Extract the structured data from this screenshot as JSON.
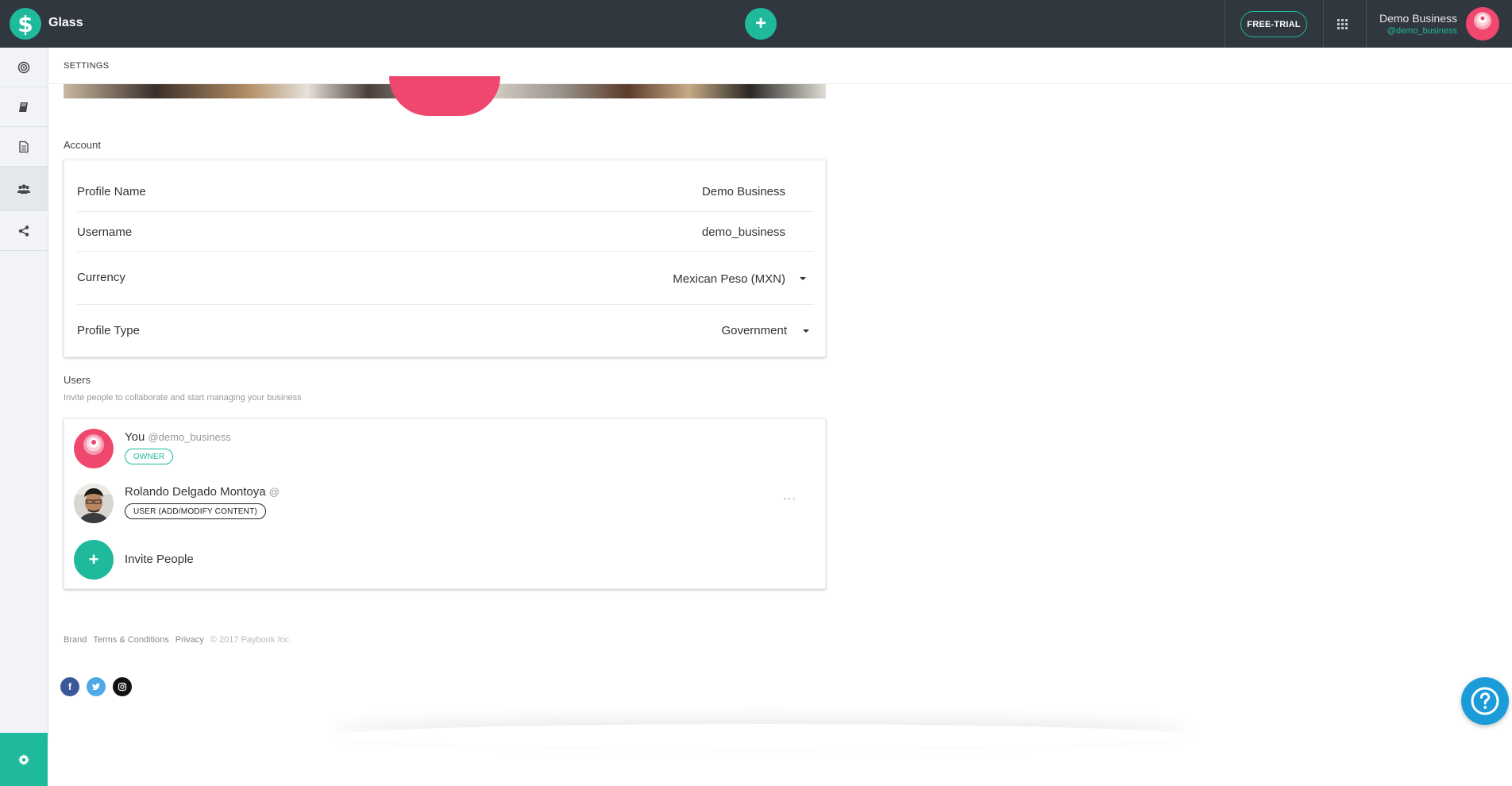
{
  "app": {
    "title": "Glass",
    "logo_glyph": "$"
  },
  "topbar": {
    "add_glyph": "+",
    "free_trial_label": "FREE-TRIAL",
    "user": {
      "name": "Demo Business",
      "handle": "@demo_business"
    }
  },
  "sidebar": {
    "items": [
      {
        "icon": "target-icon"
      },
      {
        "icon": "book-icon"
      },
      {
        "icon": "document-icon"
      },
      {
        "icon": "users-icon"
      },
      {
        "icon": "share-icon"
      }
    ],
    "settings_icon": "gear-icon"
  },
  "page": {
    "title": "SETTINGS"
  },
  "account": {
    "section_title": "Account",
    "rows": [
      {
        "label": "Profile Name",
        "value": "Demo Business"
      },
      {
        "label": "Username",
        "value": "demo_business"
      },
      {
        "label": "Currency",
        "value": "Mexican Peso (MXN)"
      },
      {
        "label": "Profile Type",
        "value": "Government"
      }
    ]
  },
  "users": {
    "section_title": "Users",
    "subtitle": "Invite people to collaborate and start managing your business",
    "list": [
      {
        "name": "You",
        "handle": "@demo_business",
        "role": "OWNER"
      },
      {
        "name": "Rolando Delgado Montoya",
        "handle": "@",
        "role": "USER (ADD/MODIFY CONTENT)",
        "more": "···"
      }
    ],
    "invite": {
      "glyph": "+",
      "label": "Invite People"
    }
  },
  "footer": {
    "links": [
      "Brand",
      "Terms & Conditions",
      "Privacy"
    ],
    "copyright": "© 2017 Paybook Inc.",
    "social": [
      {
        "name": "facebook",
        "glyph": "f"
      },
      {
        "name": "twitter",
        "glyph": "t"
      },
      {
        "name": "instagram",
        "glyph": "◎"
      }
    ]
  },
  "colors": {
    "accent": "#1fba9c",
    "topbar": "#31373f",
    "avatar_pink": "#f0476f",
    "help_blue": "#1b9cd8",
    "facebook": "#3b5998",
    "twitter": "#4fa9e6",
    "instagram": "#111111"
  }
}
